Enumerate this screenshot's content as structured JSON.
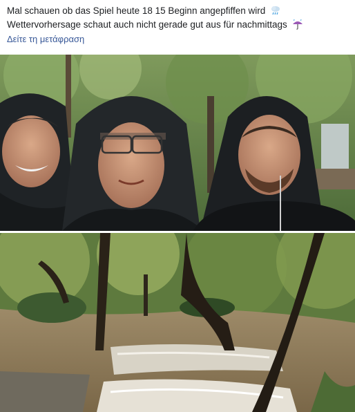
{
  "post": {
    "line1": "Mal schauen ob das Spiel heute 18 15 Beginn angepfiffen wird",
    "line1_icon": "rain-cloud-icon",
    "line2": "Wettervorhersage schaut auch nicht gerade gut aus für nachmittags",
    "line2_icon": "umbrella-rain-icon",
    "translate_link": "Δείτε τη μετάφραση",
    "link_color": "#385898"
  },
  "photos": [
    {
      "name": "selfie-three-men-hooded-rain",
      "kind": "photo"
    },
    {
      "name": "flooded-park-stream-cascade",
      "kind": "photo"
    }
  ]
}
